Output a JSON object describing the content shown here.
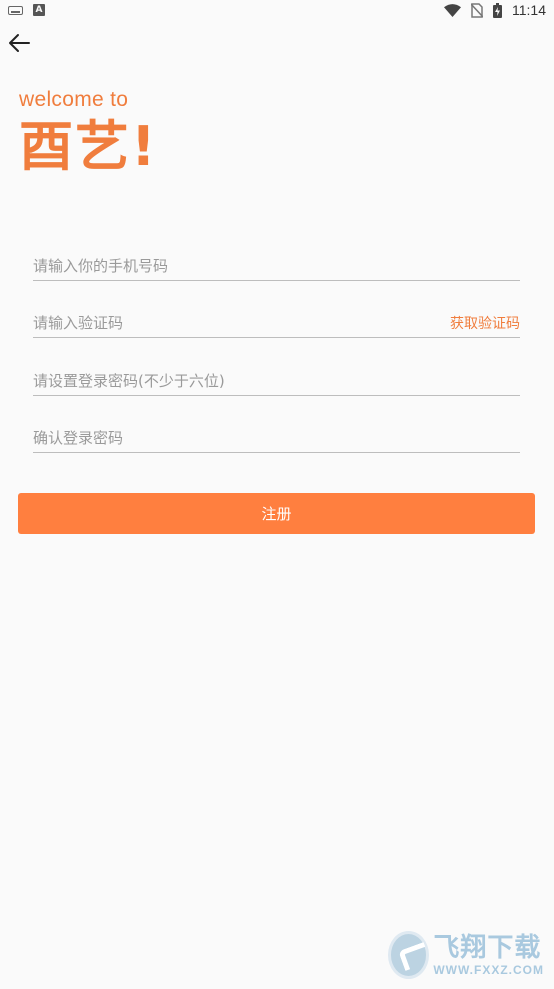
{
  "status_bar": {
    "time": "11:14",
    "left_icons": [
      "keyboard-icon",
      "a-notification-icon"
    ],
    "right_icons": [
      "wifi-icon",
      "no-sim-icon",
      "battery-charging-icon"
    ]
  },
  "nav": {
    "back_icon": "arrow-left-icon"
  },
  "header": {
    "welcome": "welcome to",
    "brand": "酉艺!"
  },
  "form": {
    "phone_placeholder": "请输入你的手机号码",
    "code_placeholder": "请输入验证码",
    "get_code_label": "获取验证码",
    "password_placeholder": "请设置登录密码(不少于六位)",
    "confirm_placeholder": "确认登录密码",
    "submit_label": "注册"
  },
  "watermark": {
    "text": "飞翔下载",
    "url": "WWW.FXXZ.COM"
  },
  "colors": {
    "accent": "#f07d3d",
    "button": "#ff7f3f",
    "background": "#fafafa"
  }
}
